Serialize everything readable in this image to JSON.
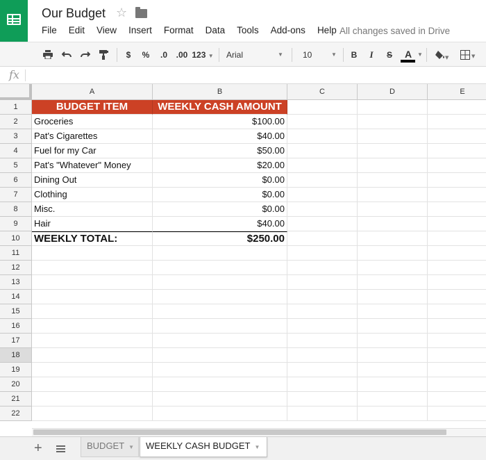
{
  "app": {
    "doc_title": "Our Budget",
    "saved_status": "All changes saved in Drive"
  },
  "menu": [
    "File",
    "Edit",
    "View",
    "Insert",
    "Format",
    "Data",
    "Tools",
    "Add-ons",
    "Help"
  ],
  "toolbar": {
    "currency": "$",
    "percent": "%",
    "decrease_decimals": ".0",
    "increase_decimals": ".00",
    "more_formats": "123",
    "font_name": "Arial",
    "font_size": "10",
    "bold": "B",
    "italic": "I",
    "strikethrough": "S",
    "text_color": "A",
    "text_color_value": "#000000"
  },
  "formula_bar": {
    "fx_label": "fx",
    "value": ""
  },
  "columns": [
    "A",
    "B",
    "C",
    "D",
    "E"
  ],
  "rows": [
    "1",
    "2",
    "3",
    "4",
    "5",
    "6",
    "7",
    "8",
    "9",
    "10",
    "11",
    "12",
    "13",
    "14",
    "15",
    "16",
    "17",
    "18",
    "19",
    "20",
    "21",
    "22"
  ],
  "active_row": "18",
  "sheet": {
    "header": {
      "item": "BUDGET ITEM",
      "amount": "WEEKLY CASH AMOUNT",
      "fill_color": "#cc4125"
    },
    "items": [
      {
        "name": "Groceries",
        "amount": "$100.00"
      },
      {
        "name": "Pat's Cigarettes",
        "amount": "$40.00"
      },
      {
        "name": "Fuel for my Car",
        "amount": "$50.00"
      },
      {
        "name": "Pat's \"Whatever\" Money",
        "amount": "$20.00"
      },
      {
        "name": "Dining Out",
        "amount": "$0.00"
      },
      {
        "name": "Clothing",
        "amount": "$0.00"
      },
      {
        "name": "Misc.",
        "amount": "$0.00"
      },
      {
        "name": "Hair",
        "amount": "$40.00"
      }
    ],
    "total": {
      "label": "WEEKLY TOTAL:",
      "amount": "$250.00"
    }
  },
  "tabs": [
    {
      "label": "BUDGET",
      "active": false
    },
    {
      "label": "WEEKLY CASH BUDGET",
      "active": true
    }
  ],
  "colors": {
    "brand_green": "#0f9d58",
    "header_fill": "#cc4125"
  }
}
